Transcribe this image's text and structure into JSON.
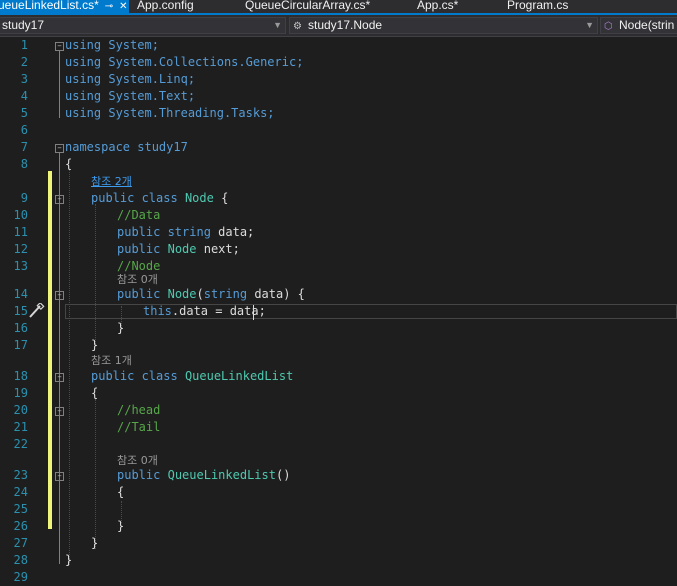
{
  "tabs": [
    {
      "label": "ueueLinkedList.cs*",
      "active": true
    },
    {
      "label": "App.config"
    },
    {
      "label": "QueueCircularArray.cs*"
    },
    {
      "label": "App.cs*"
    },
    {
      "label": "Program.cs"
    }
  ],
  "navbar": {
    "project": "study17",
    "type": "study17.Node",
    "member": "Node(strin"
  },
  "editor": {
    "line_numbers": [
      "1",
      "2",
      "3",
      "4",
      "5",
      "6",
      "7",
      "8",
      "9",
      "10",
      "11",
      "12",
      "13",
      "14",
      "15",
      "16",
      "17",
      "18",
      "19",
      "20",
      "21",
      "22",
      "23",
      "24",
      "25",
      "26",
      "27",
      "28",
      "29"
    ],
    "hints": {
      "refs2": "참조 2개",
      "refs0_a": "참조 0개",
      "refs1": "참조 1개",
      "refs0_b": "참조 0개"
    },
    "code": {
      "l1": "using System;",
      "l2": "using System.Collections.Generic;",
      "l3": "using System.Linq;",
      "l4": "using System.Text;",
      "l5": "using System.Threading.Tasks;",
      "l7": "namespace study17",
      "l8": "{",
      "l9": "public class Node {",
      "l10": "//Data",
      "l11": "public string data;",
      "l12": "public Node next;",
      "l13": "//Node",
      "l14": "public Node(string data) {",
      "l15": "this.data = data;",
      "l16": "}",
      "l17": "}",
      "l18": "public class QueueLinkedList",
      "l19": "{",
      "l20": "//head",
      "l21": "//Tail",
      "l23": "public QueueLinkedList()",
      "l24": "{",
      "l26": "}",
      "l27": "}",
      "l28": "}"
    }
  },
  "colors": {
    "keyword": "#569cd6",
    "type": "#4ec9b0",
    "comment": "#57a64a",
    "text": "#dcdcdc",
    "line_number": "#2b91af",
    "change_bar": "#eff579",
    "accent": "#007acc"
  },
  "icons": {
    "pin": "pin-icon",
    "close": "close-icon",
    "brush": "quick-action-brush-icon"
  }
}
